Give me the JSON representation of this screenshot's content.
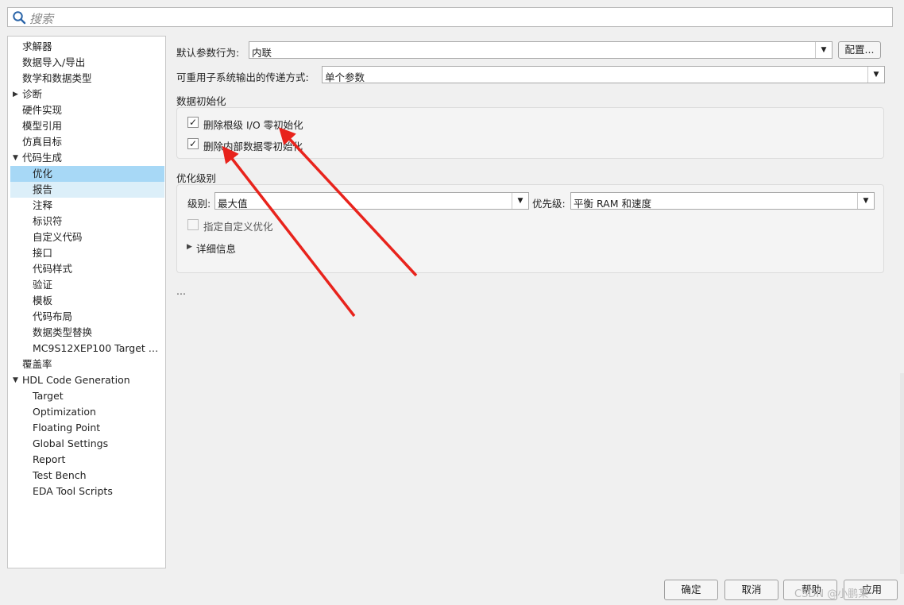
{
  "search": {
    "placeholder": "搜索"
  },
  "tree": {
    "items": [
      {
        "label": "求解器"
      },
      {
        "label": "数据导入/导出"
      },
      {
        "label": "数学和数据类型"
      },
      {
        "label": "诊断"
      },
      {
        "label": "硬件实现"
      },
      {
        "label": "模型引用"
      },
      {
        "label": "仿真目标"
      },
      {
        "label": "代码生成"
      },
      {
        "label": "优化"
      },
      {
        "label": "报告"
      },
      {
        "label": "注释"
      },
      {
        "label": "标识符"
      },
      {
        "label": "自定义代码"
      },
      {
        "label": "接口"
      },
      {
        "label": "代码样式"
      },
      {
        "label": "验证"
      },
      {
        "label": "模板"
      },
      {
        "label": "代码布局"
      },
      {
        "label": "数据类型替换"
      },
      {
        "label": "MC9S12XEP100 Target …"
      },
      {
        "label": "覆盖率"
      },
      {
        "label": "HDL Code Generation"
      },
      {
        "label": "Target"
      },
      {
        "label": "Optimization"
      },
      {
        "label": "Floating Point"
      },
      {
        "label": "Global Settings"
      },
      {
        "label": "Report"
      },
      {
        "label": "Test Bench"
      },
      {
        "label": "EDA Tool Scripts"
      }
    ]
  },
  "main": {
    "default_param_label": "默认参数行为:",
    "default_param_value": "内联",
    "config_button": "配置...",
    "reusable_label": "可重用子系统输出的传递方式:",
    "reusable_value": "单个参数",
    "data_init_title": "数据初始化",
    "cb1_label": "删除根级 I/O 零初始化",
    "cb1_checked": "✓",
    "cb2_label": "删除内部数据零初始化",
    "cb2_checked": "✓",
    "opt_level_title": "优化级别",
    "level_label": "级别:",
    "level_value": "最大值",
    "priority_label": "优先级:",
    "priority_value": "平衡 RAM 和速度",
    "custom_opt_label": "指定自定义优化",
    "details_label": "详细信息",
    "ellipsis": "..."
  },
  "footer": {
    "ok": "确定",
    "cancel": "取消",
    "help": "帮助",
    "apply": "应用",
    "watermark": "CSDN @小鹏某"
  },
  "colors": {
    "selected_bg": "#a7d8f6",
    "hover_bg": "#dceff9",
    "arrow": "#e8231c"
  }
}
